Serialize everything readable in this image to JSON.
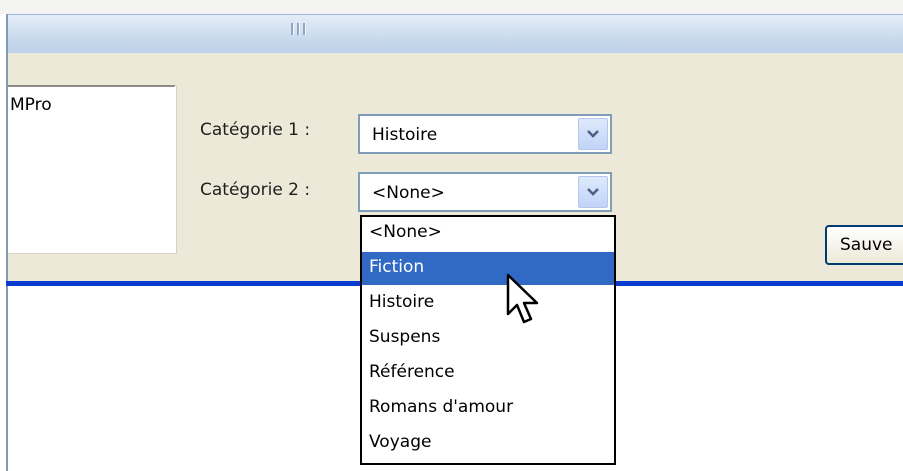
{
  "window": {
    "grip_icon": "resize-grip-icon"
  },
  "listbox": {
    "visible_text": "MPro"
  },
  "category1": {
    "label": "Catégorie 1 :",
    "value": "Histoire",
    "button_icon": "chevron-down-icon"
  },
  "category2": {
    "label": "Catégorie 2 :",
    "value": "<None>",
    "button_icon": "chevron-down-icon",
    "options": [
      "<None>",
      "Fiction",
      "Histoire",
      "Suspens",
      "Référence",
      "Romans d'amour",
      "Voyage"
    ],
    "highlighted": "Fiction"
  },
  "save_button": {
    "label": "Sauve"
  },
  "cursor": {
    "icon": "arrow-pointer-icon"
  },
  "colors": {
    "panel": "#ece9d8",
    "selection": "#316ac5",
    "separator": "#0a3cd0"
  }
}
